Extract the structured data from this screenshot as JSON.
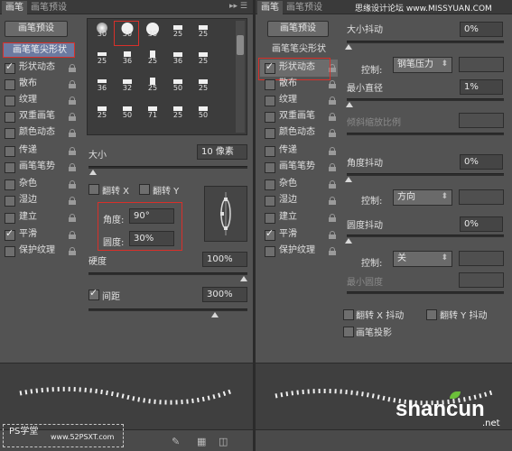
{
  "left_panel": {
    "tabs": [
      "画笔",
      "画笔预设"
    ],
    "preset_button": "画笔预设",
    "tip_shape_label": "画笔笔尖形状",
    "options": [
      {
        "label": "形状动态",
        "checked": true
      },
      {
        "label": "散布",
        "checked": false
      },
      {
        "label": "纹理",
        "checked": false
      },
      {
        "label": "双重画笔",
        "checked": false
      },
      {
        "label": "颜色动态",
        "checked": false
      },
      {
        "label": "传递",
        "checked": false
      },
      {
        "label": "画笔笔势",
        "checked": false
      },
      {
        "label": "杂色",
        "checked": false
      },
      {
        "label": "湿边",
        "checked": false
      },
      {
        "label": "建立",
        "checked": false
      },
      {
        "label": "平滑",
        "checked": true
      },
      {
        "label": "保护纹理",
        "checked": false
      }
    ],
    "brush_sizes": [
      "30",
      "30",
      "30",
      "25",
      "25",
      "25",
      "36",
      "25",
      "36",
      "25",
      "36",
      "32",
      "25",
      "50",
      "25",
      "25",
      "50",
      "71",
      "25",
      "50"
    ],
    "size_label": "大小",
    "size_value": "10 像素",
    "flip_x": "翻转 X",
    "flip_y": "翻转 Y",
    "angle_label": "角度:",
    "angle_value": "90°",
    "roundness_label": "圆度:",
    "roundness_value": "30%",
    "hardness_label": "硬度",
    "hardness_value": "100%",
    "spacing_label": "间距",
    "spacing_value": "300%",
    "spacing_checked": true
  },
  "right_panel": {
    "preset_button": "画笔预设",
    "tip_shape_label": "画笔笔尖形状",
    "options": [
      {
        "label": "形状动态",
        "checked": true
      },
      {
        "label": "散布",
        "checked": false
      },
      {
        "label": "纹理",
        "checked": false
      },
      {
        "label": "双重画笔",
        "checked": false
      },
      {
        "label": "颜色动态",
        "checked": false
      },
      {
        "label": "传递",
        "checked": false
      },
      {
        "label": "画笔笔势",
        "checked": false
      },
      {
        "label": "杂色",
        "checked": false
      },
      {
        "label": "湿边",
        "checked": false
      },
      {
        "label": "建立",
        "checked": false
      },
      {
        "label": "平滑",
        "checked": true
      },
      {
        "label": "保护纹理",
        "checked": false
      }
    ],
    "size_jitter_label": "大小抖动",
    "size_jitter_value": "0%",
    "control_label": "控制:",
    "control1_value": "钢笔压力",
    "min_diameter_label": "最小直径",
    "min_diameter_value": "1%",
    "tilt_scale_label": "倾斜缩放比例",
    "angle_jitter_label": "角度抖动",
    "angle_jitter_value": "0%",
    "control2_value": "方向",
    "roundness_jitter_label": "圆度抖动",
    "roundness_jitter_value": "0%",
    "control3_value": "关",
    "min_roundness_label": "最小圆度",
    "flip_x_jitter": "翻转 X 抖动",
    "flip_y_jitter": "翻转 Y 抖动",
    "brush_projection": "画笔投影"
  },
  "watermarks": {
    "top_right": "思缘设计论坛 www.MISSYUAN.COM",
    "bottom_left": "PS学堂",
    "bottom_url": "www.52PSXT.com",
    "bottom_right": "shancun",
    "bottom_right_small": ".net"
  }
}
